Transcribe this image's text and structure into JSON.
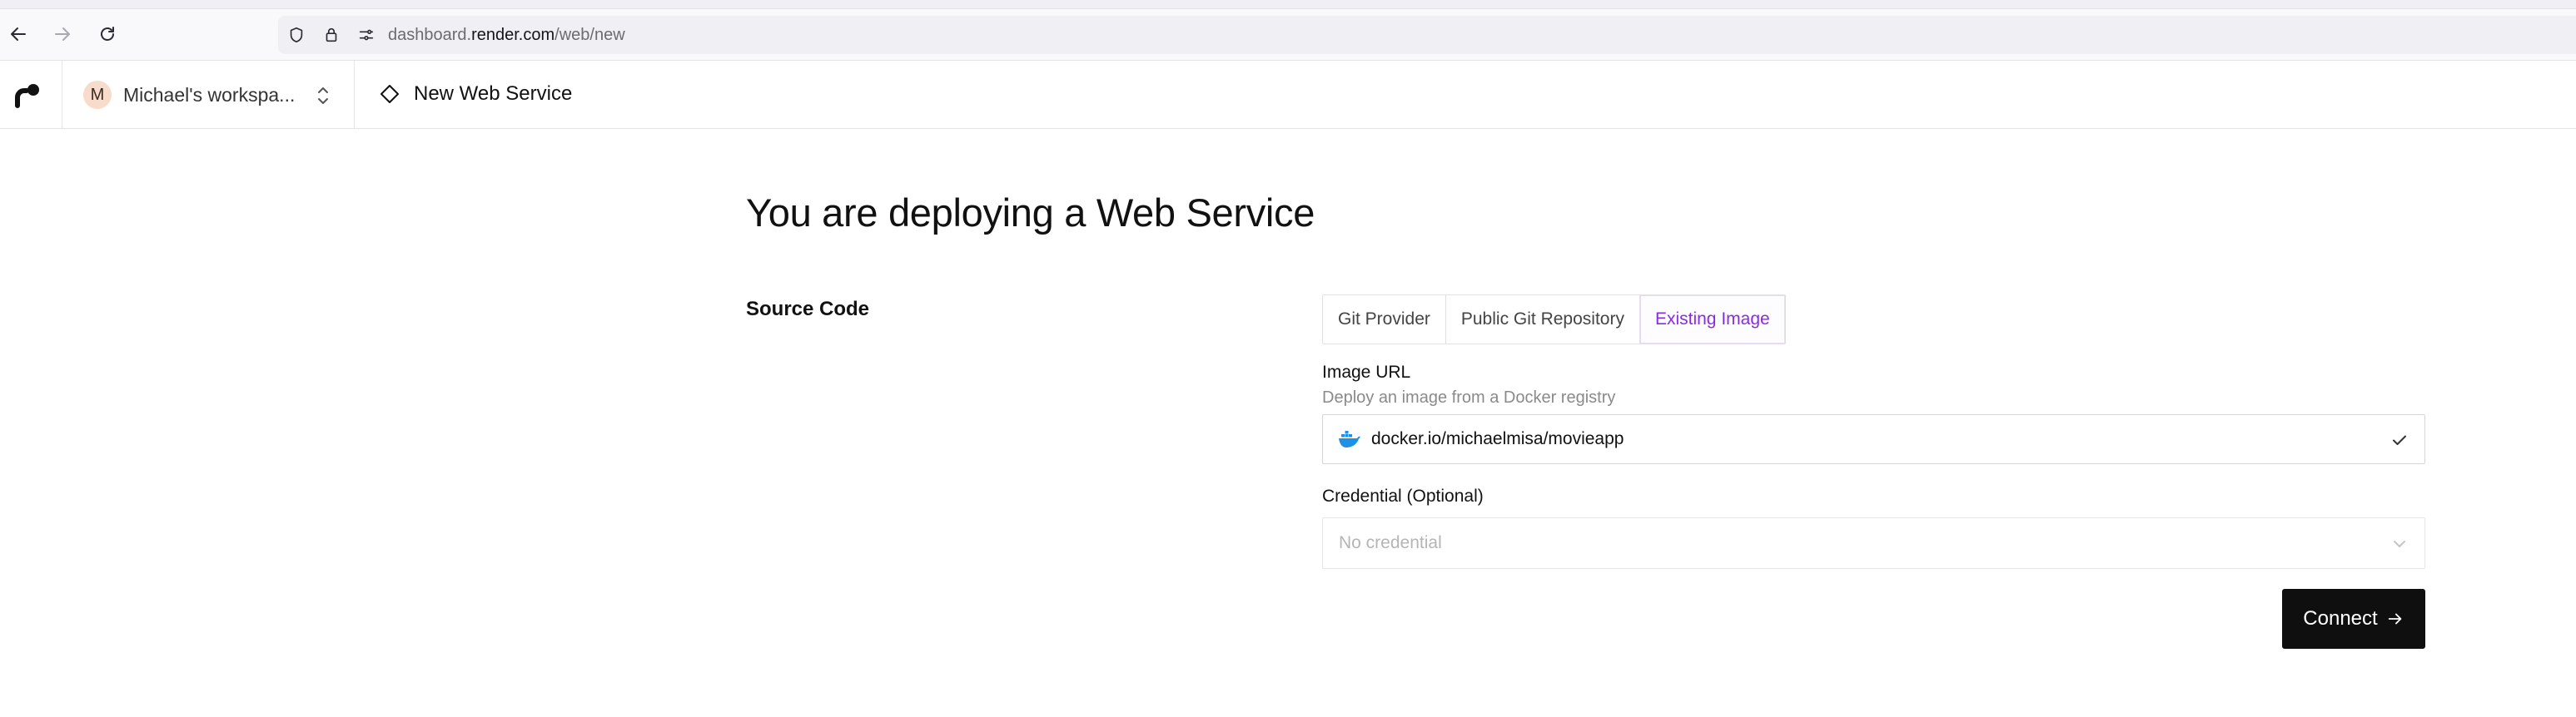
{
  "browser": {
    "url_prefix": "dashboard.",
    "url_domain": "render.com",
    "url_path": "/web/new",
    "icons": {
      "back": "back-arrow-icon",
      "forward": "forward-arrow-icon",
      "reload": "reload-icon",
      "shield": "shield-icon",
      "lock": "lock-icon",
      "permissions": "permissions-icon"
    }
  },
  "header": {
    "workspace_initial": "M",
    "workspace_name": "Michael's workspa...",
    "breadcrumb": "New Web Service"
  },
  "main": {
    "title": "You are deploying a Web Service",
    "section_label": "Source Code",
    "tabs": [
      {
        "label": "Git Provider",
        "active": false
      },
      {
        "label": "Public Git Repository",
        "active": false
      },
      {
        "label": "Existing Image",
        "active": true
      }
    ],
    "image_url": {
      "label": "Image URL",
      "help": "Deploy an image from a Docker registry",
      "value": "docker.io/michaelmisa/movieapp"
    },
    "credential": {
      "label": "Credential (Optional)",
      "placeholder": "No credential"
    },
    "connect_label": "Connect"
  },
  "colors": {
    "accent": "#8a2be2",
    "button_bg": "#0f0f10",
    "docker_blue": "#1d91e6"
  }
}
